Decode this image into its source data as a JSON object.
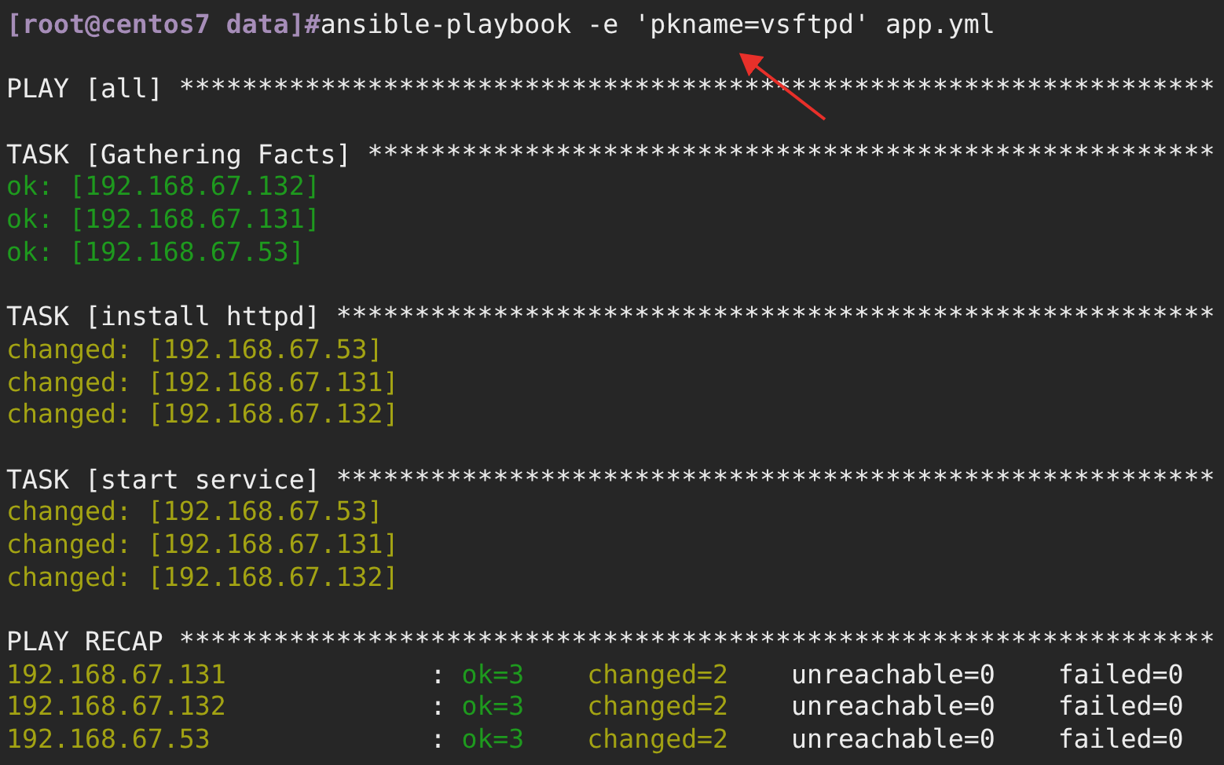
{
  "lines": [
    {
      "kind": "prompt",
      "prompt": "[root@centos7 data]#",
      "command": "ansible-playbook -e 'pkname=vsftpd' app.yml"
    },
    {
      "kind": "blank"
    },
    {
      "kind": "header",
      "text": "PLAY [all]",
      "rule": "******************************************************************"
    },
    {
      "kind": "blank"
    },
    {
      "kind": "header",
      "text": "TASK [Gathering Facts]",
      "rule": "******************************************************"
    },
    {
      "kind": "ok",
      "text": "ok: [192.168.67.132]"
    },
    {
      "kind": "ok",
      "text": "ok: [192.168.67.131]"
    },
    {
      "kind": "ok",
      "text": "ok: [192.168.67.53]"
    },
    {
      "kind": "blank"
    },
    {
      "kind": "header",
      "text": "TASK [install httpd]",
      "rule": "********************************************************"
    },
    {
      "kind": "changed",
      "text": "changed: [192.168.67.53]"
    },
    {
      "kind": "changed",
      "text": "changed: [192.168.67.131]"
    },
    {
      "kind": "changed",
      "text": "changed: [192.168.67.132]"
    },
    {
      "kind": "blank"
    },
    {
      "kind": "header",
      "text": "TASK [start service]",
      "rule": "********************************************************"
    },
    {
      "kind": "changed",
      "text": "changed: [192.168.67.53]"
    },
    {
      "kind": "changed",
      "text": "changed: [192.168.67.131]"
    },
    {
      "kind": "changed",
      "text": "changed: [192.168.67.132]"
    },
    {
      "kind": "blank"
    },
    {
      "kind": "header",
      "text": "PLAY RECAP",
      "rule": "******************************************************************"
    },
    {
      "kind": "recap",
      "host": "192.168.67.131",
      "sep": ":",
      "ok": "ok=3",
      "changed": "changed=2",
      "unreachable": "unreachable=0",
      "failed": "failed=0"
    },
    {
      "kind": "recap",
      "host": "192.168.67.132",
      "sep": ":",
      "ok": "ok=3",
      "changed": "changed=2",
      "unreachable": "unreachable=0",
      "failed": "failed=0"
    },
    {
      "kind": "recap",
      "host": "192.168.67.53",
      "sep": ":",
      "ok": "ok=3",
      "changed": "changed=2",
      "unreachable": "unreachable=0",
      "failed": "failed=0"
    }
  ]
}
